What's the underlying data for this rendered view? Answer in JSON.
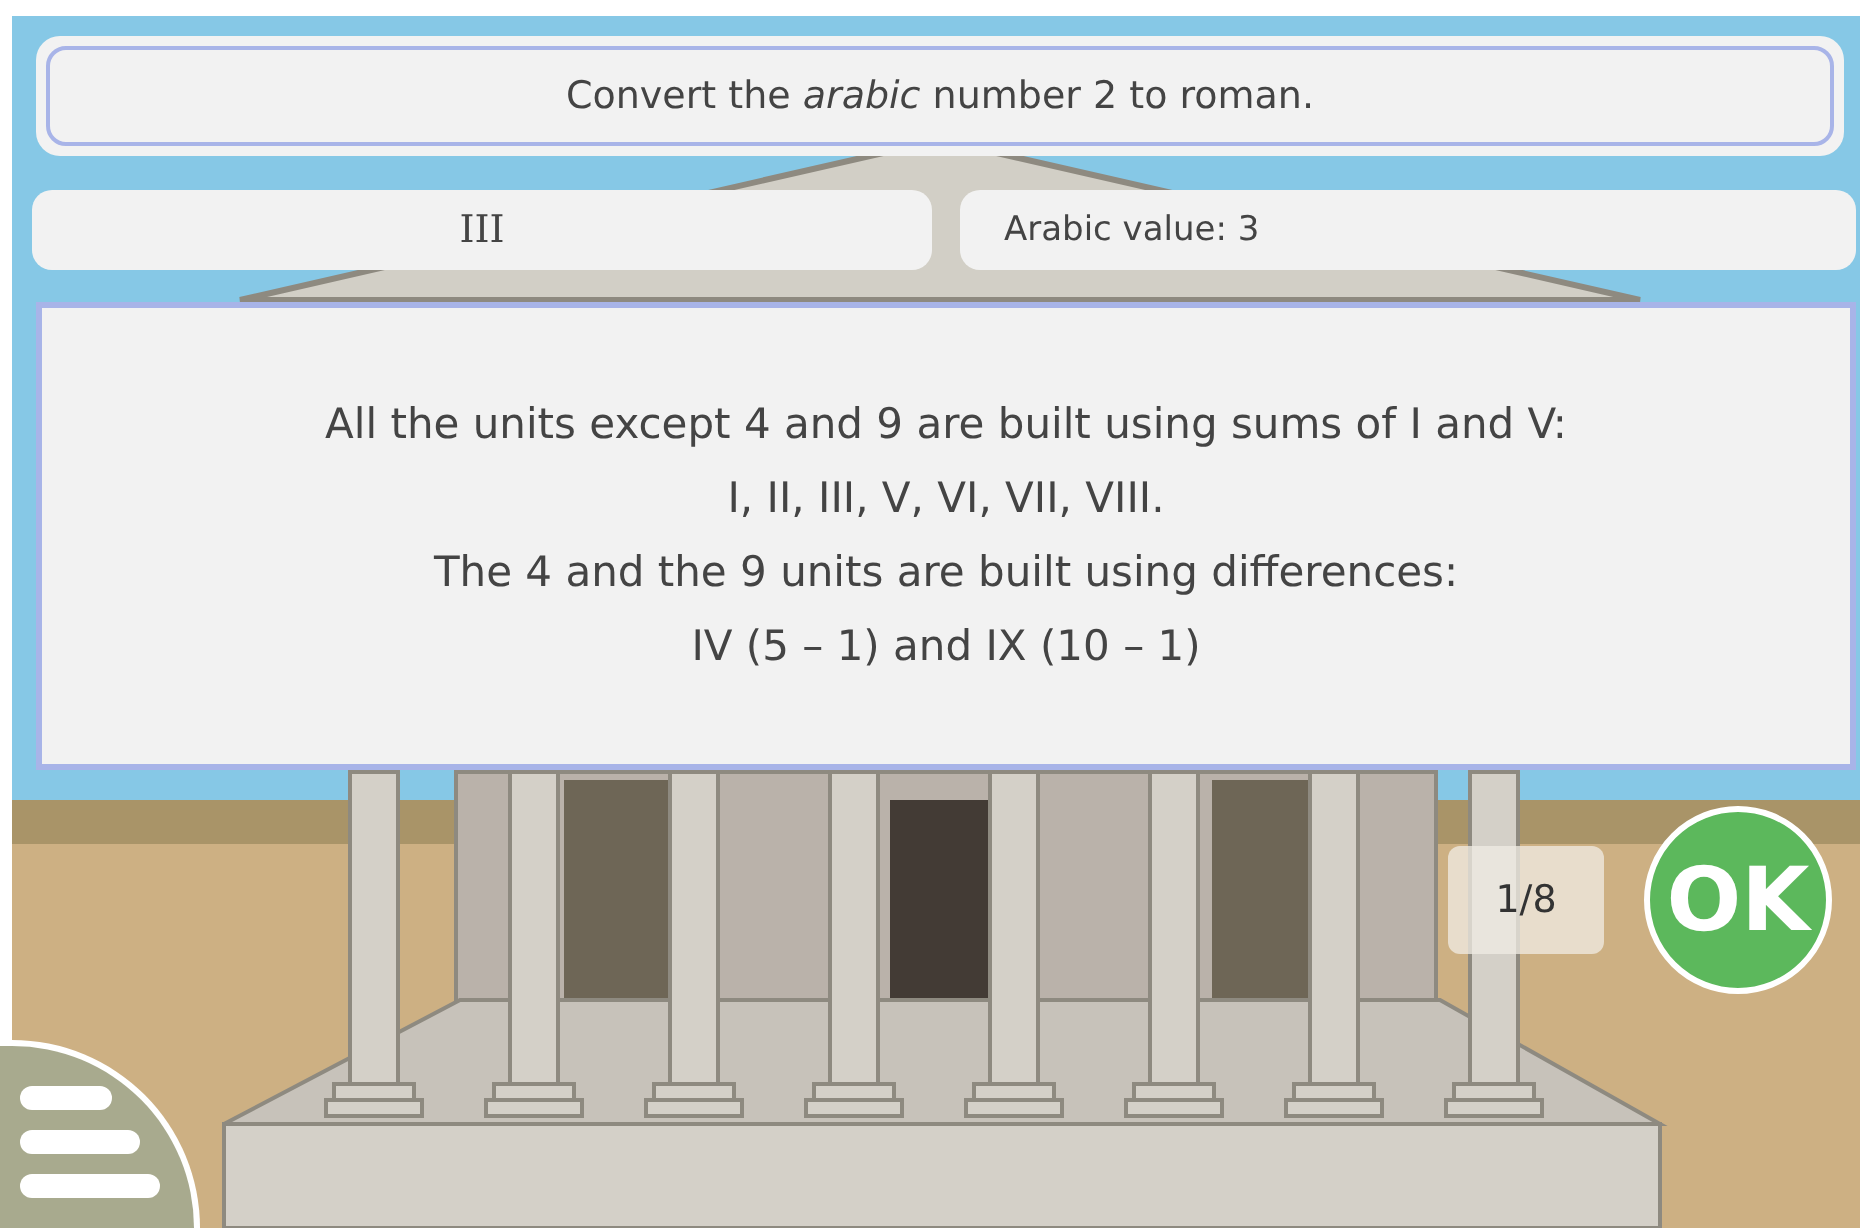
{
  "question": "Convert the *arabic* number 2 to roman.",
  "answer": {
    "value": "III"
  },
  "arabic_value": "Arabic value: 3",
  "explanation": [
    "All the units except 4 and 9 are built using sums of I and V:",
    "I, II, III, V, VI, VII, VIII.",
    "The 4 and the 9 units are built using differences:",
    "IV (5 – 1) and IX (10 – 1)"
  ],
  "progress": "1/8",
  "ok_button": "OK"
}
